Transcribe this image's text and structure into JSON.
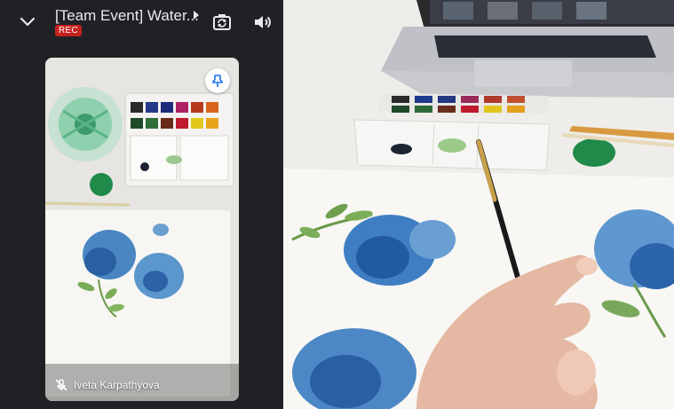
{
  "header": {
    "title": "[Team Event] Water...",
    "rec_badge": "REC",
    "icons": {
      "collapse": "chevron-down-icon",
      "title_arrow": "arrow-right-icon",
      "switch_camera": "switch-camera-icon",
      "speaker": "speaker-icon"
    }
  },
  "tile": {
    "participant_name": "Iveta Karpathyova",
    "mic_icon": "mic-off-icon",
    "pin_icon": "pin-icon"
  },
  "colors": {
    "background": "#202124",
    "rec": "#c5221f",
    "pin_accent": "#1a73e8"
  }
}
